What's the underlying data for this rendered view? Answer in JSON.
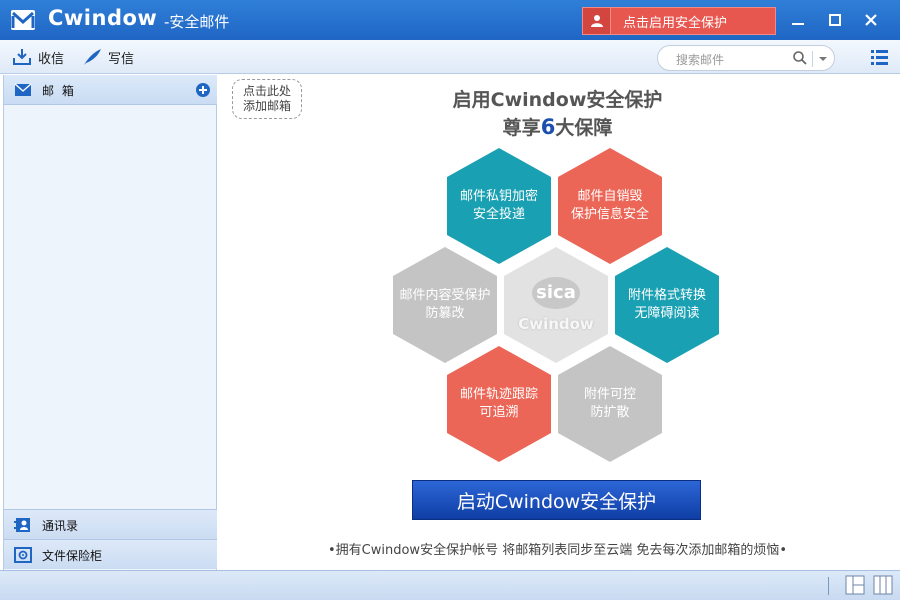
{
  "window": {
    "app_name": "Cwindow",
    "app_subtitle": "-安全邮件",
    "protect_button": "点击启用安全保护"
  },
  "toolbar": {
    "receive_label": "收信",
    "compose_label": "写信",
    "search_placeholder": "搜索邮件"
  },
  "sidebar": {
    "mailbox_label": "邮 箱",
    "contacts_label": "通讯录",
    "vault_label": "文件保险柜"
  },
  "main": {
    "add_mailbox_line1": "点击此处",
    "add_mailbox_line2": "添加邮箱",
    "headline_line1": "启用Cwindow安全保护",
    "headline_pre": "尊享",
    "headline_num": "6",
    "headline_post": "大保障",
    "hexagons": [
      {
        "line1": "邮件私钥加密",
        "line2": "安全投递"
      },
      {
        "line1": "邮件自销毁",
        "line2": "保护信息安全"
      },
      {
        "line1": "邮件内容受保护",
        "line2": "防篡改"
      },
      {
        "line1": "附件格式转换",
        "line2": "无障碍阅读"
      },
      {
        "line1": "邮件轨迹跟踪",
        "line2": "可追溯"
      },
      {
        "line1": "附件可控",
        "line2": "防扩散"
      }
    ],
    "center_logo_text": "sica",
    "center_brand": "Cwindow",
    "start_button": "启动Cwindow安全保护",
    "footer_note": "•拥有Cwindow安全保护帐号 将邮箱列表同步至云端 免去每次添加邮箱的烦恼•"
  },
  "colors": {
    "titlebar": "#1f66c4",
    "accent_red": "#ec6657",
    "accent_teal": "#1aa0b3",
    "inactive_gray": "#c4c4c4",
    "start_button": "#1447b5"
  }
}
